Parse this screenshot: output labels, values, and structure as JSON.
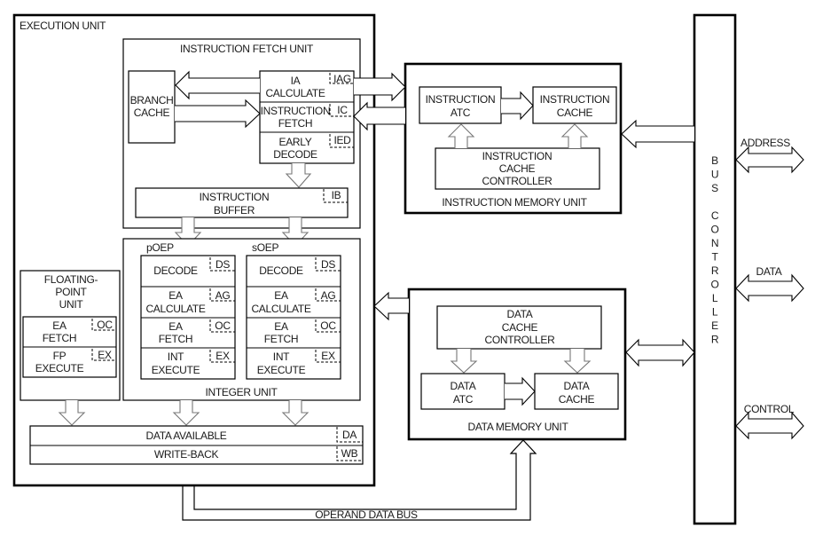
{
  "execution_unit": {
    "title": "EXECUTION UNIT",
    "instruction_fetch_unit": {
      "title": "INSTRUCTION FETCH UNIT",
      "branch_cache": [
        "BRANCH",
        "CACHE"
      ],
      "stages": [
        {
          "lines": [
            "IA",
            "CALCULATE"
          ],
          "tag": "IAG"
        },
        {
          "lines": [
            "INSTRUCTION",
            "FETCH"
          ],
          "tag": "IC"
        },
        {
          "lines": [
            "EARLY",
            "DECODE"
          ],
          "tag": "IED"
        }
      ],
      "instruction_buffer": {
        "lines": [
          "INSTRUCTION",
          "BUFFER"
        ],
        "tag": "IB"
      }
    },
    "floating_point_unit": {
      "title": [
        "FLOATING-",
        "POINT",
        "UNIT"
      ],
      "stages": [
        {
          "lines": [
            "EA",
            "FETCH"
          ],
          "tag": "OC"
        },
        {
          "lines": [
            "FP",
            "EXECUTE"
          ],
          "tag": "EX"
        }
      ]
    },
    "integer_unit": {
      "title": "INTEGER UNIT",
      "pipelines": [
        {
          "name": "pOEP",
          "stages": [
            {
              "lines": [
                "DECODE"
              ],
              "tag": "DS"
            },
            {
              "lines": [
                "EA",
                "CALCULATE"
              ],
              "tag": "AG"
            },
            {
              "lines": [
                "EA",
                "FETCH"
              ],
              "tag": "OC"
            },
            {
              "lines": [
                "INT",
                "EXECUTE"
              ],
              "tag": "EX"
            }
          ]
        },
        {
          "name": "sOEP",
          "stages": [
            {
              "lines": [
                "DECODE"
              ],
              "tag": "DS"
            },
            {
              "lines": [
                "EA",
                "CALCULATE"
              ],
              "tag": "AG"
            },
            {
              "lines": [
                "EA",
                "FETCH"
              ],
              "tag": "OC"
            },
            {
              "lines": [
                "INT",
                "EXECUTE"
              ],
              "tag": "EX"
            }
          ]
        }
      ]
    },
    "data_available": {
      "label": "DATA AVAILABLE",
      "tag": "DA"
    },
    "write_back": {
      "label": "WRITE-BACK",
      "tag": "WB"
    }
  },
  "instruction_memory_unit": {
    "title": "INSTRUCTION MEMORY UNIT",
    "atc": [
      "INSTRUCTION",
      "ATC"
    ],
    "cache": [
      "INSTRUCTION",
      "CACHE"
    ],
    "controller": [
      "INSTRUCTION",
      "CACHE",
      "CONTROLLER"
    ]
  },
  "data_memory_unit": {
    "title": "DATA MEMORY UNIT",
    "controller": [
      "DATA",
      "CACHE",
      "CONTROLLER"
    ],
    "atc": [
      "DATA",
      "ATC"
    ],
    "cache": [
      "DATA",
      "CACHE"
    ]
  },
  "bus_controller": {
    "label": "BUS CONTROLLER",
    "external_buses": [
      "ADDRESS",
      "DATA",
      "CONTROL"
    ]
  },
  "operand_data_bus": "OPERAND DATA BUS"
}
